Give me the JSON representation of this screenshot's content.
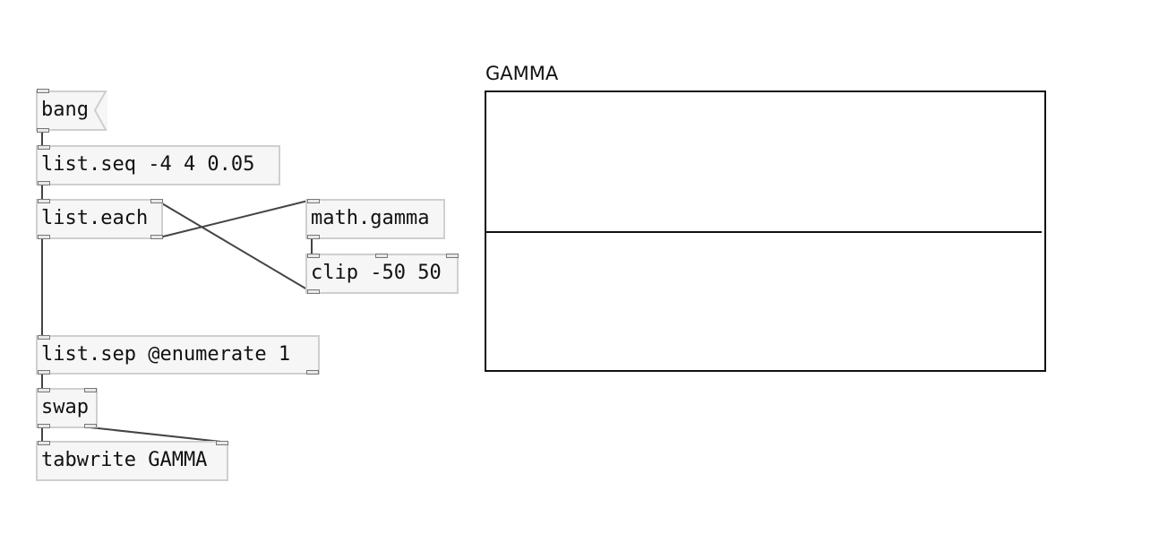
{
  "patch": {
    "bang_message": "bang",
    "objects": {
      "list_seq": "list.seq -4 4 0.05",
      "list_each": "list.each",
      "math_gamma": "math.gamma",
      "clip": "clip -50 50",
      "list_sep": "list.sep @enumerate 1",
      "swap": "swap",
      "tabwrite": "tabwrite GAMMA"
    },
    "array": {
      "name": "GAMMA"
    }
  }
}
